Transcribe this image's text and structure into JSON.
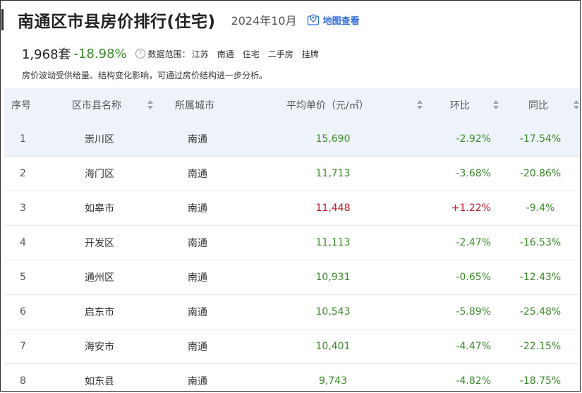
{
  "header": {
    "title": "南通区市县房价排行(住宅)",
    "period": "2024年10月",
    "map_link": "地图查看"
  },
  "summary": {
    "count": "1,968套",
    "change": "-18.98%",
    "help_icon": "?",
    "scope_label": "数据范围：",
    "scope_items": [
      "江苏",
      "南通",
      "住宅",
      "二手房",
      "挂牌"
    ],
    "note": "房价波动受供给量、结构变化影响，可通过房价结构进一步分析。"
  },
  "table": {
    "columns": [
      "序号",
      "区市县名称",
      "所属城市",
      "平均单价（元/㎡）",
      "环比",
      "同比"
    ],
    "rows": [
      {
        "rank": "1",
        "name": "崇川区",
        "city": "南通",
        "price": "15,690",
        "mom": "-2.92%",
        "yoy": "-17.54%",
        "trend": "down"
      },
      {
        "rank": "2",
        "name": "海门区",
        "city": "南通",
        "price": "11,713",
        "mom": "-3.68%",
        "yoy": "-20.86%",
        "trend": "down"
      },
      {
        "rank": "3",
        "name": "如皋市",
        "city": "南通",
        "price": "11,448",
        "mom": "+1.22%",
        "yoy": "-9.4%",
        "trend": "up"
      },
      {
        "rank": "4",
        "name": "开发区",
        "city": "南通",
        "price": "11,113",
        "mom": "-2.47%",
        "yoy": "-16.53%",
        "trend": "down"
      },
      {
        "rank": "5",
        "name": "通州区",
        "city": "南通",
        "price": "10,931",
        "mom": "-0.65%",
        "yoy": "-12.43%",
        "trend": "down"
      },
      {
        "rank": "6",
        "name": "启东市",
        "city": "南通",
        "price": "10,543",
        "mom": "-5.89%",
        "yoy": "-25.48%",
        "trend": "down"
      },
      {
        "rank": "7",
        "name": "海安市",
        "city": "南通",
        "price": "10,401",
        "mom": "-4.47%",
        "yoy": "-22.15%",
        "trend": "down"
      },
      {
        "rank": "8",
        "name": "如东县",
        "city": "南通",
        "price": "9,743",
        "mom": "-4.82%",
        "yoy": "-18.75%",
        "trend": "down"
      }
    ]
  },
  "colors": {
    "down": "#3c8a2c",
    "up": "#c0182a",
    "link": "#2f6fd6",
    "header_bg": "#eef3fa"
  },
  "icons": {
    "map": "map-pin-icon",
    "help": "help-circle-icon",
    "sort": "sort-icon"
  }
}
